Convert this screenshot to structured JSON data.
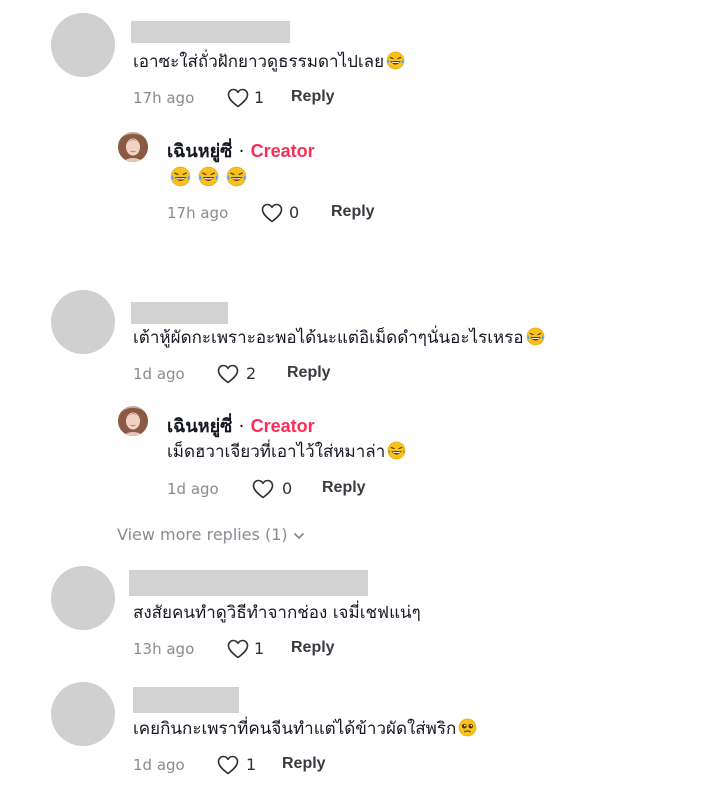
{
  "comments": [
    {
      "text": "เอาซะใส่ถั่วฝักยาวดูธรรมดาไปเลย",
      "emoji": "laughing-tears",
      "time": "17h ago",
      "likes": "1",
      "reply_label": "Reply",
      "reply": {
        "author": "เฉินหยู่ซี่",
        "dot": "·",
        "tag": "Creator",
        "emoji_count": 3,
        "time": "17h ago",
        "likes": "0",
        "reply_label": "Reply"
      }
    },
    {
      "text": "เต้าหู้ผัดกะเพราะอะพอได้นะแต่อิเม็ดดำๆนั่นอะไรเหรอ",
      "emoji": "laughing-tears",
      "time": "1d ago",
      "likes": "2",
      "reply_label": "Reply",
      "reply": {
        "author": "เฉินหยู่ซี่",
        "dot": "·",
        "tag": "Creator",
        "text": "เม็ดฮวาเจียวที่เอาไว้ใส่หมาล่า",
        "time": "1d ago",
        "likes": "0",
        "reply_label": "Reply"
      },
      "view_more": "View more replies (1)"
    },
    {
      "text": "สงสัยคนทำดูวิธีทำจากช่อง เจมี่เชฟแน่ๆ",
      "time": "13h ago",
      "likes": "1",
      "reply_label": "Reply"
    },
    {
      "text": "เคยกินกะเพราที่คนจีนทำแต่ได้ข้าวผัดใส่พริก",
      "emoji": "pleading-face",
      "time": "1d ago",
      "likes": "1",
      "reply_label": "Reply"
    }
  ],
  "colors": {
    "creator_tag": "#fe2c55",
    "meta_text": "#8a8b91",
    "redaction": "#d2d2d2"
  }
}
